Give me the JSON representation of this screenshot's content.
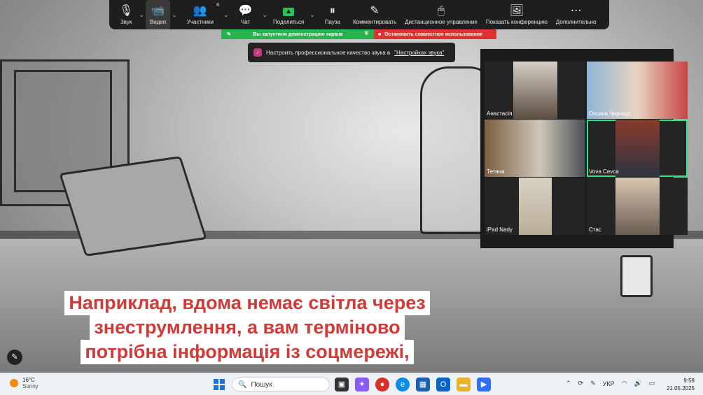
{
  "toolbar": {
    "items": [
      {
        "label": "Звук",
        "icon": "microphone-icon"
      },
      {
        "label": "Видео",
        "icon": "video-camera-icon"
      },
      {
        "label": "Участники",
        "icon": "participants-icon",
        "count": "8"
      },
      {
        "label": "Чат",
        "icon": "chat-icon"
      },
      {
        "label": "Поделиться",
        "icon": "share-screen-icon"
      },
      {
        "label": "Пауза",
        "icon": "pause-icon"
      },
      {
        "label": "Комментировать",
        "icon": "annotate-pen-icon"
      },
      {
        "label": "Дистанционное управление",
        "icon": "mouse-icon"
      },
      {
        "label": "Показать конференцию",
        "icon": "show-meeting-icon"
      },
      {
        "label": "Дополнительно",
        "icon": "more-icon"
      }
    ]
  },
  "share_bar": {
    "status": "Вы запустили демонстрацию экрана",
    "stop": "Остановить совместное использование"
  },
  "notice": {
    "text": "Настроить профессиональное качество звука в",
    "link": "\"Настройках звука\""
  },
  "gallery": {
    "participants": [
      {
        "name": "Анастасія"
      },
      {
        "name": "Оксана Черноус"
      },
      {
        "name": "Тетяна"
      },
      {
        "name": "Vova Cevca",
        "speaking": true
      },
      {
        "name": "iPad Nady"
      },
      {
        "name": "Стас"
      }
    ]
  },
  "caption": {
    "line1": "Наприклад, вдома немає світла через",
    "line2": "знеструмлення, а вам терміново",
    "line3": "потрібна інформація із соцмережі,"
  },
  "taskbar": {
    "weather": {
      "temp": "16°C",
      "condition": "Sunny"
    },
    "search_placeholder": "Пошук",
    "lang": "УКР",
    "time": "9:58",
    "date": "21.05.2025"
  },
  "colors": {
    "accent_green": "#27b34d",
    "stop_red": "#e03131",
    "caption_red": "#d23a37",
    "active_speaker": "#2ee68a"
  }
}
